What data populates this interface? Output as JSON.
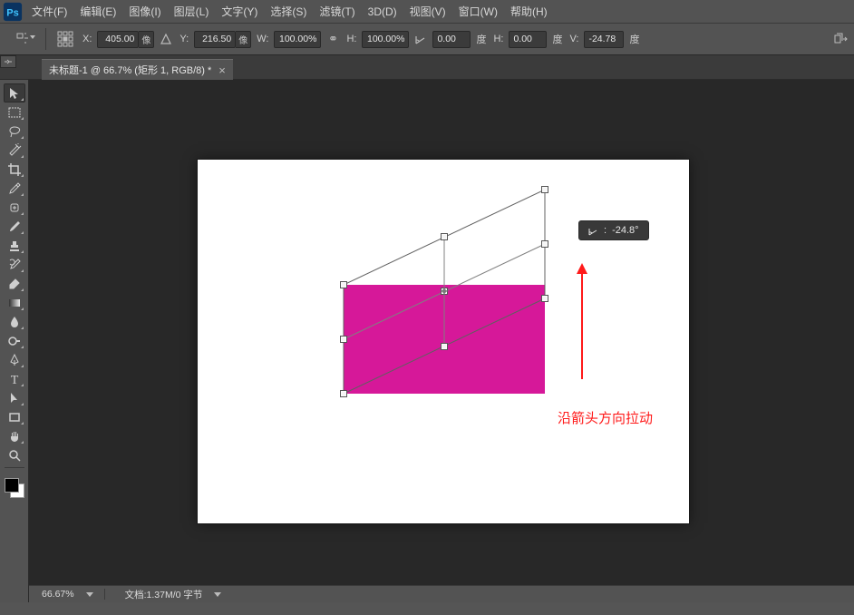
{
  "menu": {
    "items": [
      "文件(F)",
      "编辑(E)",
      "图像(I)",
      "图层(L)",
      "文字(Y)",
      "选择(S)",
      "滤镜(T)",
      "3D(D)",
      "视图(V)",
      "窗口(W)",
      "帮助(H)"
    ]
  },
  "options": {
    "x_label": "X:",
    "x_val": "405.00",
    "x_unit": "像",
    "y_label": "Y:",
    "y_val": "216.50",
    "y_unit": "像",
    "w_label": "W:",
    "w_val": "100.00%",
    "link": "⚭",
    "h_label": "H:",
    "h_val": "100.00%",
    "rot_label": "",
    "rot_val": "0.00",
    "rot_unit": "度",
    "hskew_label": "H:",
    "hskew_val": "0.00",
    "hskew_unit": "度",
    "vskew_label": "V:",
    "vskew_val": "-24.78",
    "vskew_unit": "度"
  },
  "tab": {
    "title": "未标题-1 @ 66.7% (矩形 1, RGB/8) *"
  },
  "tooltip": {
    "angle": "-24.8°"
  },
  "annotation": {
    "text": "沿箭头方向拉动"
  },
  "status": {
    "zoom": "66.67%",
    "doc": "文档:1.37M/0 字节"
  },
  "colors": {
    "rect": "#d61899",
    "arrow": "#ff1a1a"
  }
}
